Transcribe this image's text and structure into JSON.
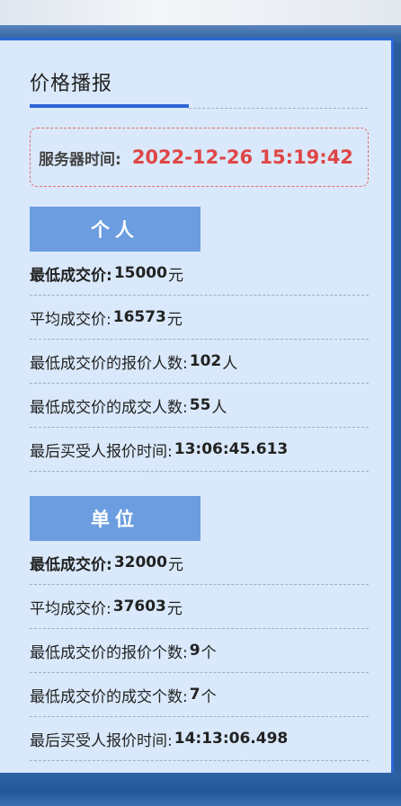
{
  "header": {
    "title": "价格播报"
  },
  "server_time": {
    "label": "服务器时间:",
    "value": "2022-12-26 15:19:42"
  },
  "individual": {
    "button_label": "个人",
    "rows": [
      {
        "label": "最低成交价:",
        "value": "15000",
        "unit": "元"
      },
      {
        "label": "平均成交价:",
        "value": "16573",
        "unit": "元"
      },
      {
        "label": "最低成交价的报价人数:",
        "value": "102",
        "unit": "人"
      },
      {
        "label": "最低成交价的成交人数:",
        "value": "55",
        "unit": "人"
      },
      {
        "label": "最后买受人报价时间:",
        "value": "13:06:45.613",
        "unit": ""
      }
    ]
  },
  "unit": {
    "button_label": "单位",
    "rows": [
      {
        "label": "最低成交价:",
        "value": "32000",
        "unit": "元"
      },
      {
        "label": "平均成交价:",
        "value": "37603",
        "unit": "元"
      },
      {
        "label": "最低成交价的报价个数:",
        "value": "9",
        "unit": "个"
      },
      {
        "label": "最低成交价的成交个数:",
        "value": "7",
        "unit": "个"
      },
      {
        "label": "最后买受人报价时间:",
        "value": "14:13:06.498",
        "unit": ""
      }
    ]
  },
  "colors": {
    "accent": "#2e64d6",
    "time_red": "#e04646",
    "section_button": "#6c9de0",
    "panel_bg": "#d9e9fb"
  }
}
